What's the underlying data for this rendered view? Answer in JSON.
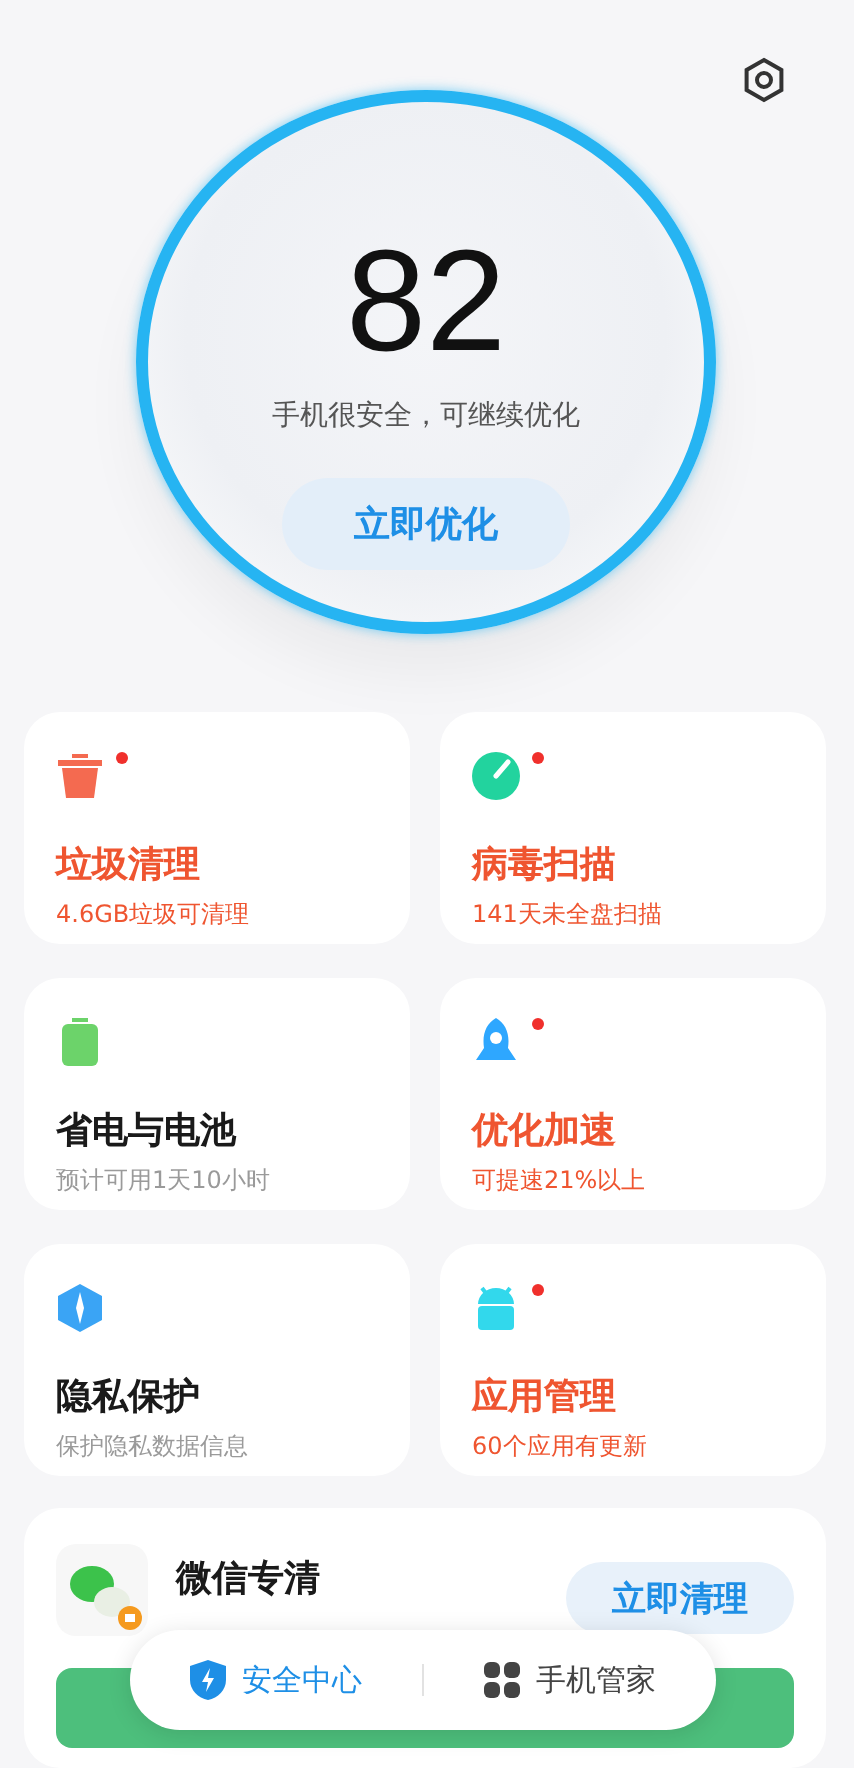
{
  "score": "82",
  "status": "手机很安全，可继续优化",
  "optimize_button": "立即优化",
  "tools": [
    {
      "title": "垃圾清理",
      "subtitle": "4.6GB垃圾可清理",
      "alert": true,
      "warning": true
    },
    {
      "title": "病毒扫描",
      "subtitle": "141天未全盘扫描",
      "alert": true,
      "warning": true
    },
    {
      "title": "省电与电池",
      "subtitle": "预计可用1天10小时",
      "alert": false,
      "warning": false
    },
    {
      "title": "优化加速",
      "subtitle": "可提速21%以上",
      "alert": true,
      "warning": true
    },
    {
      "title": "隐私保护",
      "subtitle": "保护隐私数据信息",
      "alert": false,
      "warning": false
    },
    {
      "title": "应用管理",
      "subtitle": "60个应用有更新",
      "alert": true,
      "warning": true
    }
  ],
  "wechat_clean": {
    "title": "微信专清",
    "button": "立即清理"
  },
  "bottom_nav": [
    {
      "label": "安全中心",
      "selected": true
    },
    {
      "label": "手机管家",
      "selected": false
    }
  ]
}
